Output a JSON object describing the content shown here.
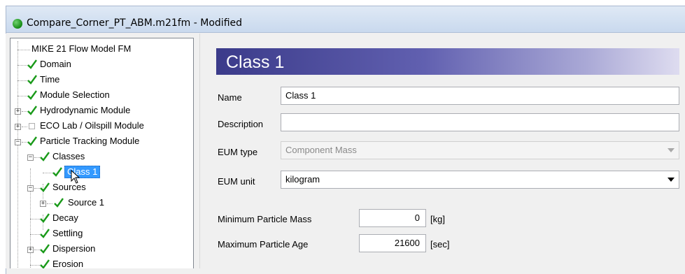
{
  "window": {
    "title": "Compare_Corner_PT_ABM.m21fm - Modified"
  },
  "tree": {
    "items": [
      {
        "label": "MIKE 21 Flow Model FM",
        "checked": false
      },
      {
        "label": "Domain",
        "checked": true
      },
      {
        "label": "Time",
        "checked": true
      },
      {
        "label": "Module Selection",
        "checked": true
      },
      {
        "label": "Hydrodynamic Module",
        "checked": true,
        "expander": "+"
      },
      {
        "label": "ECO Lab / Oilspill Module",
        "checked": false,
        "expander": "+"
      },
      {
        "label": "Particle Tracking Module",
        "checked": true,
        "expander": "−"
      },
      {
        "label": "Classes",
        "checked": true,
        "expander": "−"
      },
      {
        "label": "Class 1",
        "checked": true,
        "selected": true
      },
      {
        "label": "Sources",
        "checked": true,
        "expander": "−"
      },
      {
        "label": "Source 1",
        "checked": true,
        "expander": "+"
      },
      {
        "label": "Decay",
        "checked": true
      },
      {
        "label": "Settling",
        "checked": true
      },
      {
        "label": "Dispersion",
        "checked": true,
        "expander": "+"
      },
      {
        "label": "Erosion",
        "checked": true
      }
    ]
  },
  "panel": {
    "header": "Class 1",
    "name_label": "Name",
    "name_value": "Class 1",
    "description_label": "Description",
    "description_value": "",
    "eum_type_label": "EUM type",
    "eum_type_value": "Component Mass",
    "eum_unit_label": "EUM unit",
    "eum_unit_value": "kilogram",
    "min_mass_label": "Minimum Particle Mass",
    "min_mass_value": "0",
    "min_mass_unit": "[kg]",
    "max_age_label": "Maximum Particle Age",
    "max_age_value": "21600",
    "max_age_unit": "[sec]"
  },
  "colors": {
    "check_green": "#1a9a1a",
    "selection_blue": "#3399ff",
    "header_gradient_start": "#3b3b8a"
  }
}
